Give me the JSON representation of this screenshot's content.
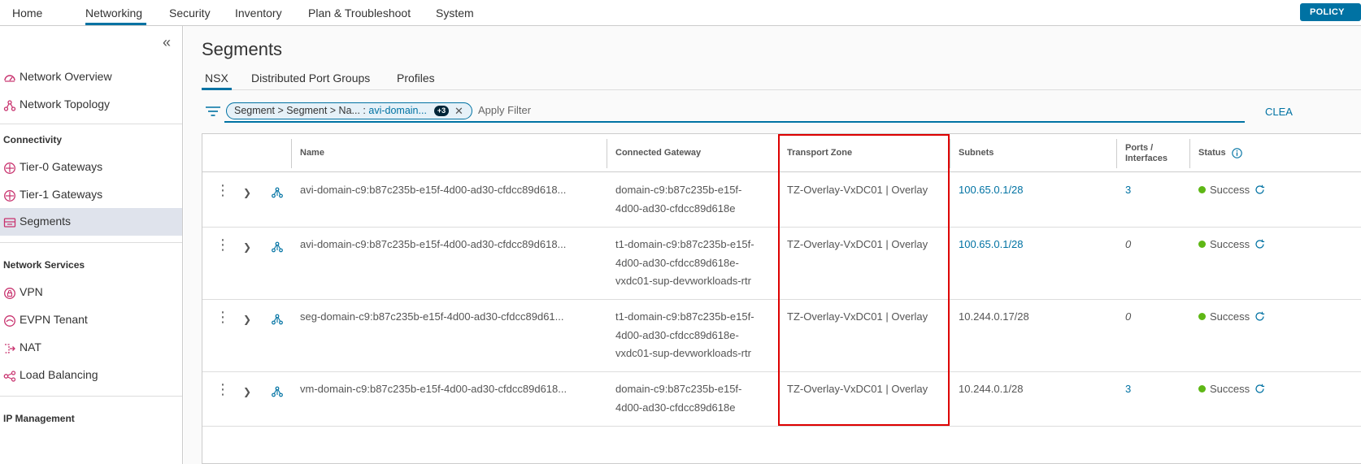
{
  "topnav": {
    "items": [
      "Home",
      "Networking",
      "Security",
      "Inventory",
      "Plan & Troubleshoot",
      "System"
    ],
    "policy_label": "POLICY"
  },
  "sidebar": {
    "overview": "Network Overview",
    "topology": "Network Topology",
    "connectivity_head": "Connectivity",
    "tier0": "Tier-0 Gateways",
    "tier1": "Tier-1 Gateways",
    "segments": "Segments",
    "services_head": "Network Services",
    "vpn": "VPN",
    "evpn": "EVPN Tenant",
    "nat": "NAT",
    "lb": "Load Balancing",
    "ipm_head": "IP Management"
  },
  "page": {
    "title": "Segments",
    "tabs": [
      "NSX",
      "Distributed Port Groups",
      "Profiles"
    ]
  },
  "filter": {
    "chip_prefix": "Segment > Segment > Na... : ",
    "chip_value": "avi-domain...",
    "chip_badge": "+3",
    "placeholder": "Apply Filter",
    "clear": "CLEA"
  },
  "table": {
    "headers": {
      "name": "Name",
      "gateway": "Connected Gateway",
      "tz": "Transport Zone",
      "subnets": "Subnets",
      "ports_1": "Ports /",
      "ports_2": "Interfaces",
      "status": "Status"
    },
    "rows": [
      {
        "name": "avi-domain-c9:b87c235b-e15f-4d00-ad30-cfdcc89d618...",
        "gw1": "domain-c9:b87c235b-e15f-",
        "gw2": "4d00-ad30-cfdcc89d618e",
        "gw3": "",
        "tz": "TZ-Overlay-VxDC01 | Overlay",
        "subnet": "100.65.0.1/28",
        "ports": "3",
        "status": "Success"
      },
      {
        "name": "avi-domain-c9:b87c235b-e15f-4d00-ad30-cfdcc89d618...",
        "gw1": "t1-domain-c9:b87c235b-e15f-",
        "gw2": "4d00-ad30-cfdcc89d618e-",
        "gw3": "vxdc01-sup-devworkloads-rtr",
        "tz": "TZ-Overlay-VxDC01 | Overlay",
        "subnet": "100.65.0.1/28",
        "ports": "0",
        "status": "Success"
      },
      {
        "name": "seg-domain-c9:b87c235b-e15f-4d00-ad30-cfdcc89d61...",
        "gw1": "t1-domain-c9:b87c235b-e15f-",
        "gw2": "4d00-ad30-cfdcc89d618e-",
        "gw3": "vxdc01-sup-devworkloads-rtr",
        "tz": "TZ-Overlay-VxDC01 | Overlay",
        "subnet": "10.244.0.17/28",
        "ports": "0",
        "status": "Success"
      },
      {
        "name": "vm-domain-c9:b87c235b-e15f-4d00-ad30-cfdcc89d618...",
        "gw1": "domain-c9:b87c235b-e15f-",
        "gw2": "4d00-ad30-cfdcc89d618e",
        "gw3": "",
        "tz": "TZ-Overlay-VxDC01 | Overlay",
        "subnet": "10.244.0.1/28",
        "ports": "3",
        "status": "Success"
      }
    ]
  },
  "colors": {
    "accent": "#0072a3",
    "success": "#5eb715",
    "highlight": "#dd0000",
    "icon_pink": "#c8326e"
  }
}
